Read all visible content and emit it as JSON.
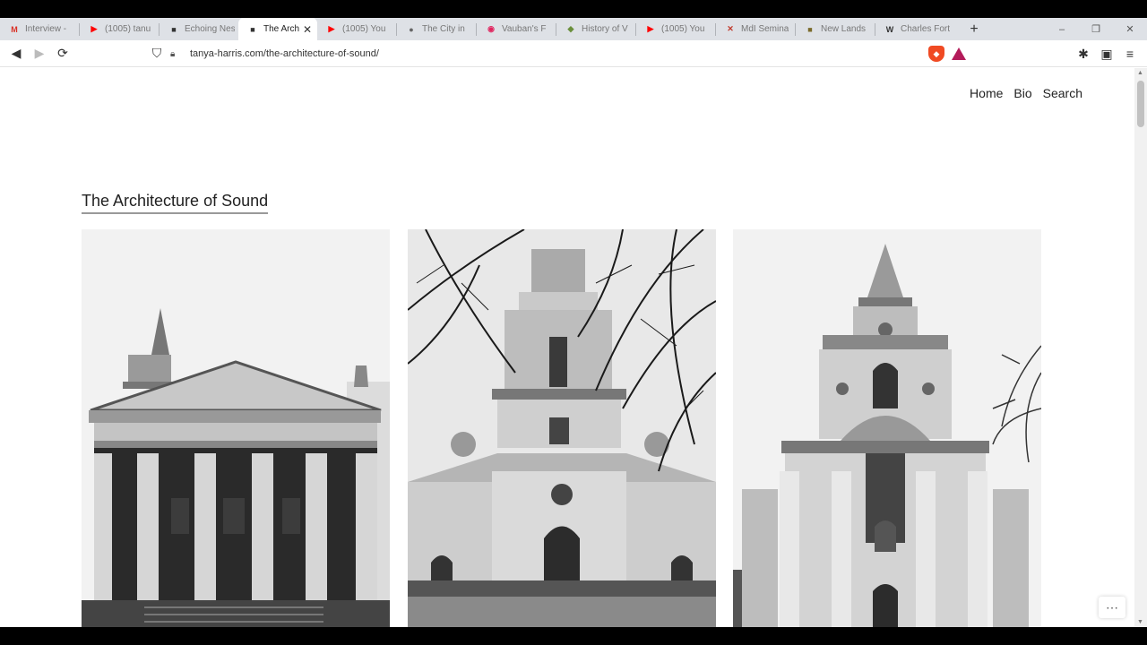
{
  "browser": {
    "tabs": [
      {
        "label": "Interview -",
        "icon": "gmail-icon",
        "color": "#d93025",
        "glyph": "M"
      },
      {
        "label": "(1005) tanu",
        "icon": "youtube-icon",
        "color": "#ff0000",
        "glyph": "▶"
      },
      {
        "label": "Echoing Nes",
        "icon": "site-icon",
        "color": "#333333",
        "glyph": "■"
      },
      {
        "label": "The Arch",
        "icon": "site-icon",
        "color": "#333333",
        "glyph": "■"
      },
      {
        "label": "(1005) You",
        "icon": "youtube-icon",
        "color": "#ff0000",
        "glyph": "▶"
      },
      {
        "label": "The City in",
        "icon": "globe-icon",
        "color": "#666666",
        "glyph": "●"
      },
      {
        "label": "Vauban's F",
        "icon": "pocket-icon",
        "color": "#e0245e",
        "glyph": "◉"
      },
      {
        "label": "History of V",
        "icon": "leaf-icon",
        "color": "#6a8f3c",
        "glyph": "◆"
      },
      {
        "label": "(1005) You",
        "icon": "youtube-icon",
        "color": "#ff0000",
        "glyph": "▶"
      },
      {
        "label": "MdI Semina",
        "icon": "x-icon",
        "color": "#c0392b",
        "glyph": "✕"
      },
      {
        "label": "New Lands",
        "icon": "book-icon",
        "color": "#7a6a2a",
        "glyph": "■"
      },
      {
        "label": "Charles Fort",
        "icon": "wikipedia-icon",
        "color": "#333333",
        "glyph": "W"
      }
    ],
    "active_tab_index": 3,
    "url": "tanya-harris.com/the-architecture-of-sound/"
  },
  "site": {
    "nav": [
      "Home",
      "Bio",
      "Search"
    ],
    "page_title": "The Architecture of Sound"
  },
  "gallery": [
    {
      "name": "portico-church-photo",
      "icon": "photo"
    },
    {
      "name": "tower-church-with-branches-photo",
      "icon": "photo"
    },
    {
      "name": "spire-church-photo",
      "icon": "photo"
    }
  ],
  "colors": {
    "accent_underline": "#999999",
    "text": "#222222"
  }
}
